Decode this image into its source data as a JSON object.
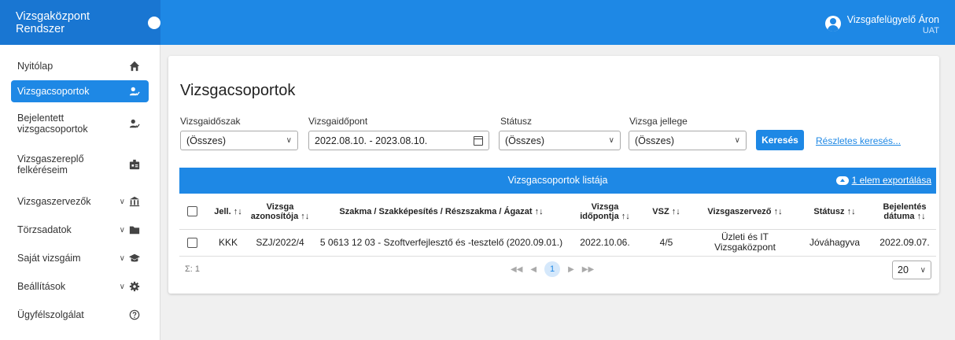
{
  "app": {
    "title": "Vizsgaközpont Rendszer"
  },
  "user": {
    "name": "Vizsgafelügyelő Áron",
    "env": "UAT"
  },
  "sidebar": {
    "items": [
      {
        "label": "Nyitólap",
        "icon": "home-icon",
        "active": false,
        "expandable": false
      },
      {
        "label": "Vizsgacsoportok",
        "icon": "user-check-icon",
        "active": true,
        "expandable": false
      },
      {
        "label": "Bejelentett vizsgacsoportok",
        "icon": "user-check-icon",
        "active": false,
        "expandable": false
      },
      {
        "label": "Vizsgaszereplő felkéréseim",
        "icon": "badge-icon",
        "active": false,
        "expandable": false
      },
      {
        "label": "Vizsgaszervezők",
        "icon": "institution-icon",
        "active": false,
        "expandable": true
      },
      {
        "label": "Törzsadatok",
        "icon": "folder-icon",
        "active": false,
        "expandable": true
      },
      {
        "label": "Saját vizsgáim",
        "icon": "graduation-cap-icon",
        "active": false,
        "expandable": true
      },
      {
        "label": "Beállítások",
        "icon": "gear-icon",
        "active": false,
        "expandable": true
      },
      {
        "label": "Ügyfélszolgálat",
        "icon": "help-icon",
        "active": false,
        "expandable": false
      }
    ]
  },
  "main": {
    "title": "Vizsgacsoportok",
    "filters": {
      "period": {
        "label": "Vizsgaidőszak",
        "value": "(Összes)"
      },
      "date": {
        "label": "Vizsgaidőpont",
        "value": "2022.08.10. - 2023.08.10."
      },
      "status": {
        "label": "Státusz",
        "value": "(Összes)"
      },
      "type": {
        "label": "Vizsga jellege",
        "value": "(Összes)"
      }
    },
    "search_label": "Keresés",
    "advanced_label": "Részletes keresés...",
    "table": {
      "title": "Vizsgacsoportok listája",
      "export_label": "1 elem exportálása",
      "columns": [
        "Jell. ↑↓",
        "Vizsga azonosítója ↑↓",
        "Szakma / Szakképesítés / Részszakma / Ágazat ↑↓",
        "Vizsga időpontja ↑↓",
        "VSZ ↑↓",
        "Vizsgaszervező ↑↓",
        "Státusz ↑↓",
        "Bejelentés dátuma ↑↓"
      ],
      "rows": [
        [
          "KKK",
          "SZJ/2022/4",
          "5 0613 12 03 - Szoftverfejlesztő és -tesztelő (2020.09.01.)",
          "2022.10.06.",
          "4/5",
          "Üzleti és IT Vizsgaközpont",
          "Jóváhagyva",
          "2022.09.07."
        ]
      ],
      "sum_label": "Σ: 1",
      "pager": {
        "first": "◀◀",
        "prev": "◀",
        "current": "1",
        "next": "▶",
        "last": "▶▶"
      },
      "page_size": "20"
    }
  },
  "colors": {
    "primary": "#1e88e5",
    "brand": "#1976d2"
  }
}
